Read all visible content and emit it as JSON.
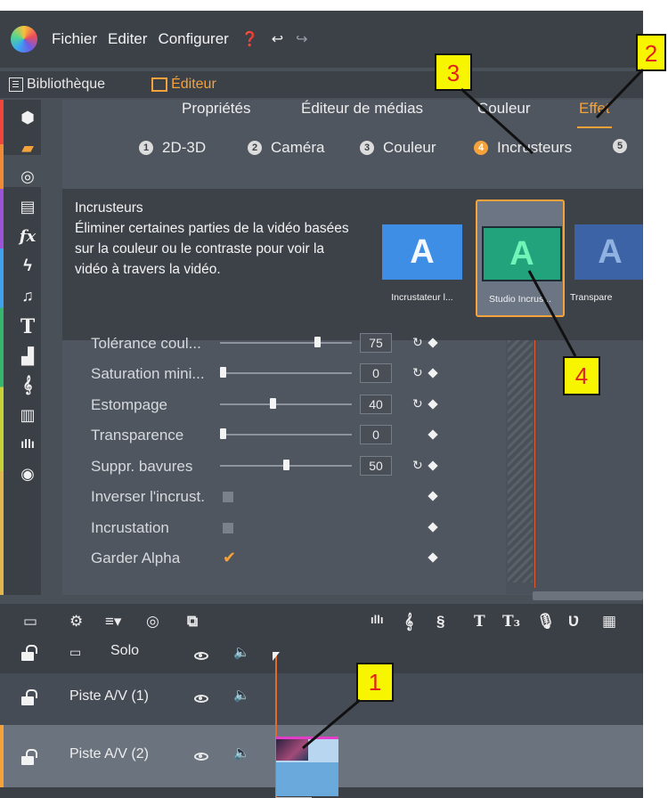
{
  "menubar": {
    "items": [
      "Fichier",
      "Editer",
      "Configurer"
    ],
    "help_icon": "help-circle-icon",
    "undo_icon": "undo-arrow-icon",
    "redo_icon": "redo-arrow-icon"
  },
  "modes": {
    "library": "Bibliothèque",
    "editor": "Éditeur"
  },
  "tabs": [
    "Propriétés",
    "Éditeur de médias",
    "Couleur",
    "Effet"
  ],
  "active_tab": "Effet",
  "subtabs": [
    {
      "num": "1",
      "label": "2D-3D"
    },
    {
      "num": "2",
      "label": "Caméra"
    },
    {
      "num": "3",
      "label": "Couleur"
    },
    {
      "num": "4",
      "label": "Incrusteurs"
    },
    {
      "num": "5",
      "label": ""
    }
  ],
  "tooltip": {
    "title": "Incrusteurs",
    "body": "Éliminer certaines parties de la vidéo basées sur la couleur ou le contraste pour voir la vidéo à travers la vidéo."
  },
  "effects": [
    {
      "label": "Incrustateur l...",
      "letter": "A",
      "color": "#3f8ee6"
    },
    {
      "label": "Studio Incrus...",
      "letter": "A",
      "color": "#23a37c"
    },
    {
      "label": "Transpare",
      "letter": "A",
      "color": "#3b63a6"
    }
  ],
  "params": [
    {
      "label": "Tolérance coul...",
      "value": "75",
      "level": 0.75
    },
    {
      "label": "Saturation mini...",
      "value": "0",
      "level": 0.0
    },
    {
      "label": "Estompage",
      "value": "40",
      "level": 0.4
    },
    {
      "label": "Transparence",
      "value": "0",
      "level": 0.0
    },
    {
      "label": "Suppr. bavures",
      "value": "50",
      "level": 0.5
    }
  ],
  "checks": [
    {
      "label": "Inverser l'incrust.",
      "checked": false
    },
    {
      "label": "Incrustation",
      "checked": false
    },
    {
      "label": "Garder Alpha",
      "checked": true
    }
  ],
  "tracks": [
    {
      "name": "Solo"
    },
    {
      "name": "Piste A/V (1)"
    },
    {
      "name": "Piste A/V (2)"
    }
  ],
  "callouts": [
    "1",
    "2",
    "3",
    "4"
  ],
  "rail_icons": [
    "box-icon",
    "folder-icon",
    "film-reel-icon",
    "stack-icon",
    "fx-icon",
    "lightning-icon",
    "music-note-icon",
    "title-T-icon",
    "overlay-icon",
    "treble-clef-icon",
    "piano-icon",
    "audio-wave-icon",
    "disc-icon"
  ]
}
